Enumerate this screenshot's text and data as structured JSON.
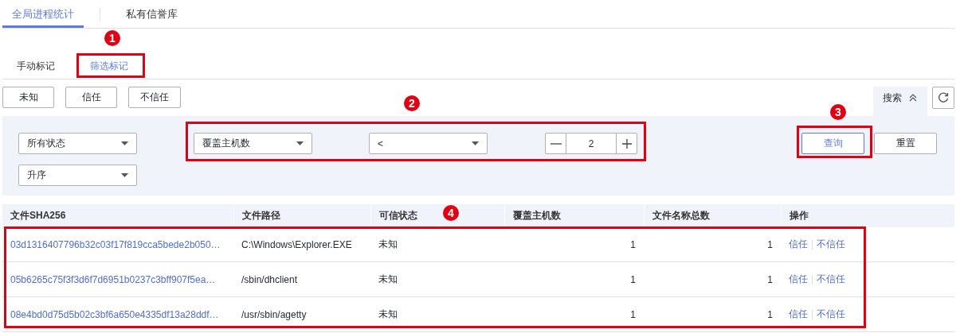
{
  "tabs": [
    {
      "label": "全局进程统计",
      "selected": true
    },
    {
      "label": "私有信誉库",
      "selected": false
    }
  ],
  "subtabs": [
    {
      "label": "手动标记",
      "selected": false
    },
    {
      "label": "筛选标记",
      "selected": true
    }
  ],
  "mark_buttons": [
    "未知",
    "信任",
    "不信任"
  ],
  "search_toggle": {
    "label": "搜索",
    "expanded": true
  },
  "filters": {
    "status_select": "所有状态",
    "field_select": "覆盖主机数",
    "operator_select": "<",
    "count": "2",
    "sort_select": "升序",
    "query_button": "查询",
    "reset_button": "重置"
  },
  "table": {
    "columns": [
      "文件SHA256",
      "文件路径",
      "可信状态",
      "覆盖主机数",
      "文件名称总数",
      "操作"
    ],
    "rows": [
      {
        "sha256": "03d1316407796b32c03f17f819cca5bede2b050…",
        "path": "C:\\Windows\\Explorer.EXE",
        "status": "未知",
        "host_count": "1",
        "name_count": "1",
        "actions": [
          "信任",
          "不信任"
        ]
      },
      {
        "sha256": "05b6265c75f3f3d6f7d6951b0237c3bff907f5ea…",
        "path": "/sbin/dhclient",
        "status": "未知",
        "host_count": "1",
        "name_count": "1",
        "actions": [
          "信任",
          "不信任"
        ]
      },
      {
        "sha256": "08e4bd0d75d5b02c3bf6a650e4335df13a28ddf…",
        "path": "/usr/sbin/agetty",
        "status": "未知",
        "host_count": "1",
        "name_count": "1",
        "actions": [
          "信任",
          "不信任"
        ]
      }
    ]
  },
  "annotations": [
    {
      "label": "1"
    },
    {
      "label": "2"
    },
    {
      "label": "3"
    },
    {
      "label": "4"
    }
  ]
}
